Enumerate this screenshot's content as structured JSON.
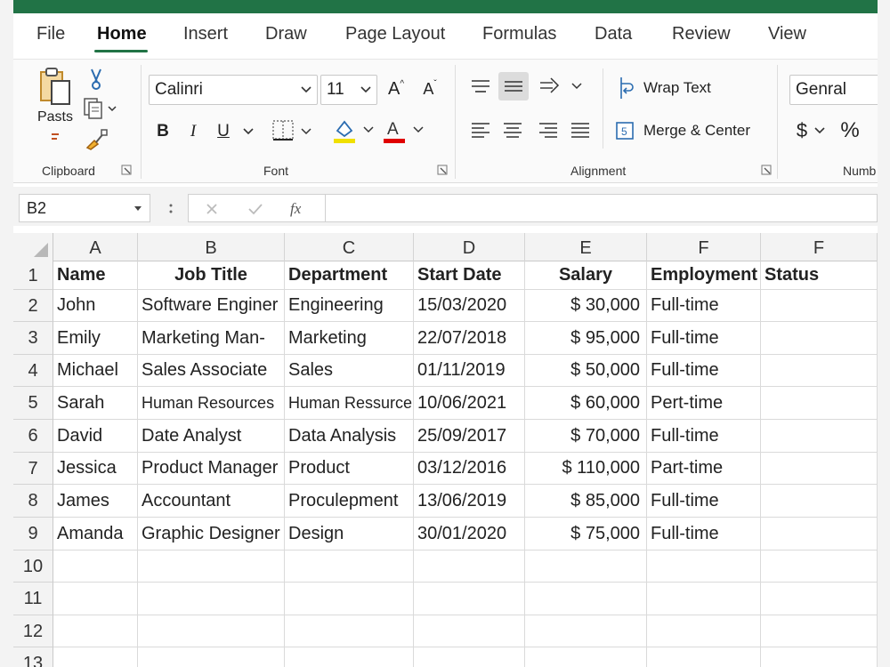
{
  "colors": {
    "title_bar": "#217346",
    "accent": "#217346",
    "fill_highlight": "#f0e000",
    "font_color": "#e00000"
  },
  "tabs": [
    "File",
    "Home",
    "Insert",
    "Draw",
    "Page Layout",
    "Formulas",
    "Data",
    "Review",
    "View"
  ],
  "active_tab": "Home",
  "ribbon": {
    "clipboard": {
      "paste_label": "Pasts",
      "group_label": "Clipboard"
    },
    "font": {
      "font_name": "Calinri",
      "font_size": "11",
      "group_label": "Font",
      "bold": "B",
      "italic": "I",
      "underline": "U",
      "increase_size": "A",
      "decrease_size": "A",
      "font_color": "A"
    },
    "alignment": {
      "wrap_text": "Wrap Text",
      "merge_center": "Merge & Center",
      "group_label": "Alignment"
    },
    "number": {
      "format": "Genral",
      "currency": "$",
      "percent": "%",
      "group_label": "Numb"
    }
  },
  "formula_bar": {
    "name_box": "B2",
    "fx": "fx",
    "formula": ""
  },
  "sheet": {
    "columns": [
      "A",
      "B",
      "C",
      "D",
      "E",
      "F",
      "F"
    ],
    "row_numbers": [
      "1",
      "2",
      "3",
      "4",
      "5",
      "6",
      "7",
      "8",
      "9",
      "10",
      "11",
      "12",
      "13"
    ],
    "header": [
      "Name",
      "Job Title",
      "Department",
      "Start Date",
      "Salary",
      "Employment",
      "Status"
    ],
    "rows": [
      [
        "John",
        "Software Enginer",
        "Engineering",
        "15/03/2020",
        "$ 30,000",
        "Full-time",
        ""
      ],
      [
        "Emily",
        "Marketing Man-",
        "Marketing",
        "22/07/2018",
        "$ 95,000",
        "Full-time",
        ""
      ],
      [
        "Michael",
        "Sales Associate",
        "Sales",
        "01/11/2019",
        "$ 50,000",
        "Full-time",
        ""
      ],
      [
        "Sarah",
        "Human Resources",
        "Human Ressurce",
        "10/06/2021",
        "$ 60,000",
        "Pert-time",
        ""
      ],
      [
        "David",
        "Date Analyst",
        "Data Analysis",
        "25/09/2017",
        "$ 70,000",
        "Full-time",
        ""
      ],
      [
        "Jessica",
        "Product Manager",
        "Product",
        "03/12/2016",
        "$ 110,000",
        "Part-time",
        ""
      ],
      [
        "James",
        "Accountant",
        "Proculepment",
        "13/06/2019",
        "$ 85,000",
        "Full-time",
        ""
      ],
      [
        "Amanda",
        "Graphic Designer",
        "Design",
        "30/01/2020",
        "$ 75,000",
        "Full-time",
        ""
      ]
    ]
  }
}
